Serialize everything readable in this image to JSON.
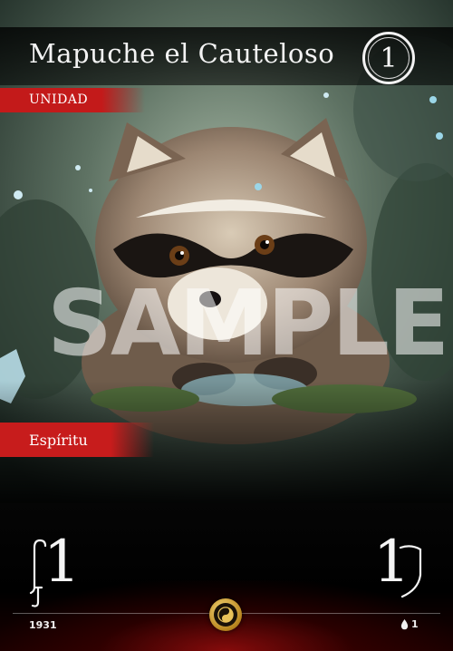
{
  "card": {
    "name": "Mapuche el Cauteloso",
    "cost": "1",
    "type": "UNIDAD",
    "subtype": "Espíritu",
    "watermark": "SAMPLE",
    "attack": "1",
    "defense": "1",
    "card_number": "1931",
    "rarity_value": "1"
  },
  "icons": {
    "attack": "sword-icon",
    "defense": "shield-icon",
    "center": "yin-yang-medal-icon",
    "rarity": "drop-icon"
  },
  "colors": {
    "accent_red": "#c31a1a",
    "gold": "#d4a63a",
    "text": "#f3f3f3"
  }
}
